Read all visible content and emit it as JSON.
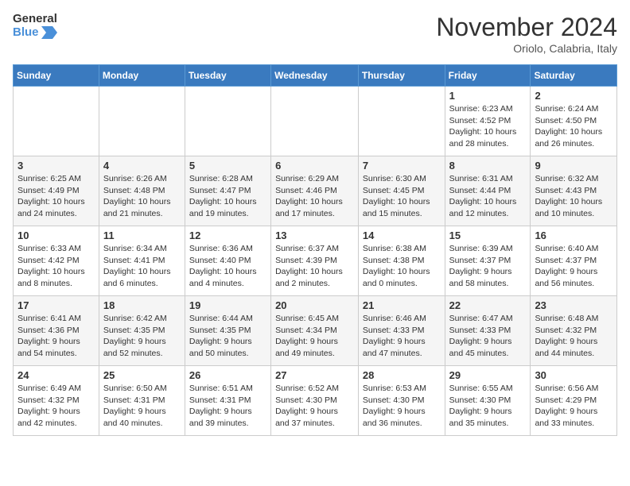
{
  "logo": {
    "line1": "General",
    "line2": "Blue"
  },
  "title": "November 2024",
  "location": "Oriolo, Calabria, Italy",
  "weekdays": [
    "Sunday",
    "Monday",
    "Tuesday",
    "Wednesday",
    "Thursday",
    "Friday",
    "Saturday"
  ],
  "weeks": [
    [
      {
        "day": "",
        "info": ""
      },
      {
        "day": "",
        "info": ""
      },
      {
        "day": "",
        "info": ""
      },
      {
        "day": "",
        "info": ""
      },
      {
        "day": "",
        "info": ""
      },
      {
        "day": "1",
        "info": "Sunrise: 6:23 AM\nSunset: 4:52 PM\nDaylight: 10 hours and 28 minutes."
      },
      {
        "day": "2",
        "info": "Sunrise: 6:24 AM\nSunset: 4:50 PM\nDaylight: 10 hours and 26 minutes."
      }
    ],
    [
      {
        "day": "3",
        "info": "Sunrise: 6:25 AM\nSunset: 4:49 PM\nDaylight: 10 hours and 24 minutes."
      },
      {
        "day": "4",
        "info": "Sunrise: 6:26 AM\nSunset: 4:48 PM\nDaylight: 10 hours and 21 minutes."
      },
      {
        "day": "5",
        "info": "Sunrise: 6:28 AM\nSunset: 4:47 PM\nDaylight: 10 hours and 19 minutes."
      },
      {
        "day": "6",
        "info": "Sunrise: 6:29 AM\nSunset: 4:46 PM\nDaylight: 10 hours and 17 minutes."
      },
      {
        "day": "7",
        "info": "Sunrise: 6:30 AM\nSunset: 4:45 PM\nDaylight: 10 hours and 15 minutes."
      },
      {
        "day": "8",
        "info": "Sunrise: 6:31 AM\nSunset: 4:44 PM\nDaylight: 10 hours and 12 minutes."
      },
      {
        "day": "9",
        "info": "Sunrise: 6:32 AM\nSunset: 4:43 PM\nDaylight: 10 hours and 10 minutes."
      }
    ],
    [
      {
        "day": "10",
        "info": "Sunrise: 6:33 AM\nSunset: 4:42 PM\nDaylight: 10 hours and 8 minutes."
      },
      {
        "day": "11",
        "info": "Sunrise: 6:34 AM\nSunset: 4:41 PM\nDaylight: 10 hours and 6 minutes."
      },
      {
        "day": "12",
        "info": "Sunrise: 6:36 AM\nSunset: 4:40 PM\nDaylight: 10 hours and 4 minutes."
      },
      {
        "day": "13",
        "info": "Sunrise: 6:37 AM\nSunset: 4:39 PM\nDaylight: 10 hours and 2 minutes."
      },
      {
        "day": "14",
        "info": "Sunrise: 6:38 AM\nSunset: 4:38 PM\nDaylight: 10 hours and 0 minutes."
      },
      {
        "day": "15",
        "info": "Sunrise: 6:39 AM\nSunset: 4:37 PM\nDaylight: 9 hours and 58 minutes."
      },
      {
        "day": "16",
        "info": "Sunrise: 6:40 AM\nSunset: 4:37 PM\nDaylight: 9 hours and 56 minutes."
      }
    ],
    [
      {
        "day": "17",
        "info": "Sunrise: 6:41 AM\nSunset: 4:36 PM\nDaylight: 9 hours and 54 minutes."
      },
      {
        "day": "18",
        "info": "Sunrise: 6:42 AM\nSunset: 4:35 PM\nDaylight: 9 hours and 52 minutes."
      },
      {
        "day": "19",
        "info": "Sunrise: 6:44 AM\nSunset: 4:35 PM\nDaylight: 9 hours and 50 minutes."
      },
      {
        "day": "20",
        "info": "Sunrise: 6:45 AM\nSunset: 4:34 PM\nDaylight: 9 hours and 49 minutes."
      },
      {
        "day": "21",
        "info": "Sunrise: 6:46 AM\nSunset: 4:33 PM\nDaylight: 9 hours and 47 minutes."
      },
      {
        "day": "22",
        "info": "Sunrise: 6:47 AM\nSunset: 4:33 PM\nDaylight: 9 hours and 45 minutes."
      },
      {
        "day": "23",
        "info": "Sunrise: 6:48 AM\nSunset: 4:32 PM\nDaylight: 9 hours and 44 minutes."
      }
    ],
    [
      {
        "day": "24",
        "info": "Sunrise: 6:49 AM\nSunset: 4:32 PM\nDaylight: 9 hours and 42 minutes."
      },
      {
        "day": "25",
        "info": "Sunrise: 6:50 AM\nSunset: 4:31 PM\nDaylight: 9 hours and 40 minutes."
      },
      {
        "day": "26",
        "info": "Sunrise: 6:51 AM\nSunset: 4:31 PM\nDaylight: 9 hours and 39 minutes."
      },
      {
        "day": "27",
        "info": "Sunrise: 6:52 AM\nSunset: 4:30 PM\nDaylight: 9 hours and 37 minutes."
      },
      {
        "day": "28",
        "info": "Sunrise: 6:53 AM\nSunset: 4:30 PM\nDaylight: 9 hours and 36 minutes."
      },
      {
        "day": "29",
        "info": "Sunrise: 6:55 AM\nSunset: 4:30 PM\nDaylight: 9 hours and 35 minutes."
      },
      {
        "day": "30",
        "info": "Sunrise: 6:56 AM\nSunset: 4:29 PM\nDaylight: 9 hours and 33 minutes."
      }
    ]
  ]
}
